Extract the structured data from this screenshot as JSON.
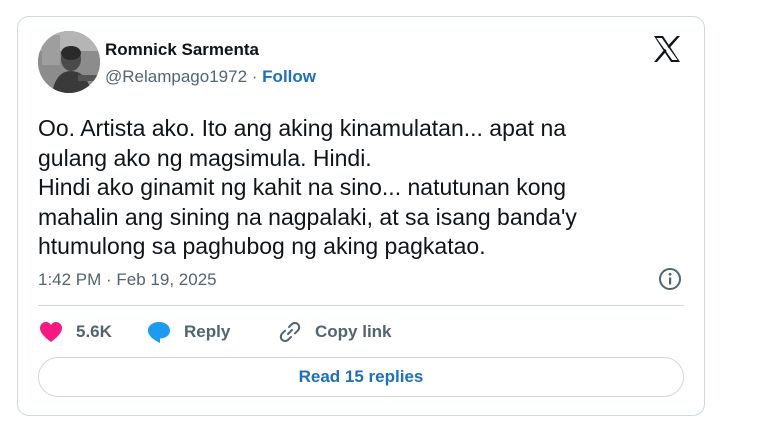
{
  "author": {
    "name": "Romnick Sarmenta",
    "handle": "@Relampago1972",
    "separator": "·",
    "follow_label": "Follow"
  },
  "tweet": {
    "text": "Oo. Artista ako. Ito ang aking kinamulatan... apat na\ngulang ako ng magsimula. Hindi.\nHindi ako ginamit ng kahit na sino... natutunan kong\nmahalin ang sining na nagpalaki, at sa isang banda'y\nhtumulong sa paghubog ng aking pagkatao.",
    "timestamp": "1:42 PM · Feb 19, 2025"
  },
  "actions": {
    "likes_count": "5.6K",
    "reply_label": "Reply",
    "copy_link_label": "Copy link"
  },
  "footer": {
    "read_replies_label": "Read 15 replies"
  },
  "colors": {
    "accent_blue": "#1d6fc1",
    "heart_pink": "#f91880",
    "reply_blue": "#1d9bf0",
    "muted_text": "#536471"
  },
  "icons": {
    "brand": "x-logo-icon",
    "info": "info-icon",
    "like": "heart-icon",
    "reply": "speech-bubble-icon",
    "copy": "link-icon"
  }
}
